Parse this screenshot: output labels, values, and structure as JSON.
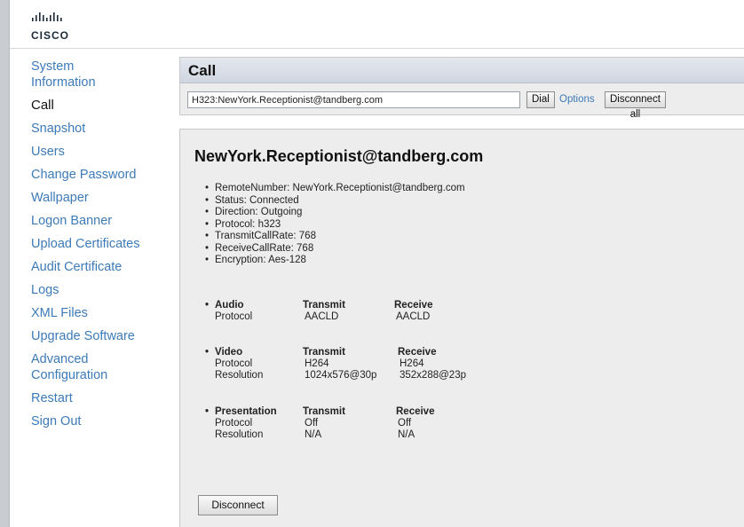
{
  "logo": {
    "wordmark": "CISCO"
  },
  "sidebar": {
    "items": [
      {
        "label": "System Information",
        "active": false
      },
      {
        "label": "Call",
        "active": true
      },
      {
        "label": "Snapshot",
        "active": false
      },
      {
        "label": "Users",
        "active": false
      },
      {
        "label": "Change Password",
        "active": false
      },
      {
        "label": "Wallpaper",
        "active": false
      },
      {
        "label": "Logon Banner",
        "active": false
      },
      {
        "label": "Upload Certificates",
        "active": false
      },
      {
        "label": "Audit Certificate",
        "active": false
      },
      {
        "label": "Logs",
        "active": false
      },
      {
        "label": "XML Files",
        "active": false
      },
      {
        "label": "Upgrade Software",
        "active": false
      },
      {
        "label": "Advanced Configuration",
        "active": false
      },
      {
        "label": "Restart",
        "active": false
      },
      {
        "label": "Sign Out",
        "active": false
      }
    ]
  },
  "call_panel": {
    "title": "Call",
    "input_value": "H323:NewYork.Receptionist@tandberg.com",
    "dial_label": "Dial",
    "options_label": "Options",
    "disconnect_all_label": "Disconnect all"
  },
  "call_detail": {
    "title": "NewYork.Receptionist@tandberg.com",
    "info": [
      "RemoteNumber: NewYork.Receptionist@tandberg.com",
      "Status: Connected",
      "Direction: Outgoing",
      "Protocol: h323",
      "TransmitCallRate: 768",
      "ReceiveCallRate: 768",
      "Encryption: Aes-128"
    ],
    "audio": {
      "name": "Audio",
      "transmit_header": "Transmit",
      "receive_header": "Receive",
      "rows": [
        {
          "label": "Protocol",
          "transmit": "AACLD",
          "receive": "AACLD"
        }
      ]
    },
    "video": {
      "name": "Video",
      "transmit_header": "Transmit",
      "receive_header": "Receive",
      "rows": [
        {
          "label": "Protocol",
          "transmit": "H264",
          "receive": "H264"
        },
        {
          "label": "Resolution",
          "transmit": "1024x576@30p",
          "receive": "352x288@23p"
        }
      ]
    },
    "presentation": {
      "name": "Presentation",
      "transmit_header": "Transmit",
      "receive_header": "Receive",
      "rows": [
        {
          "label": "Protocol",
          "transmit": "Off",
          "receive": "Off"
        },
        {
          "label": "Resolution",
          "transmit": "N/A",
          "receive": "N/A"
        }
      ]
    },
    "disconnect_label": "Disconnect"
  }
}
